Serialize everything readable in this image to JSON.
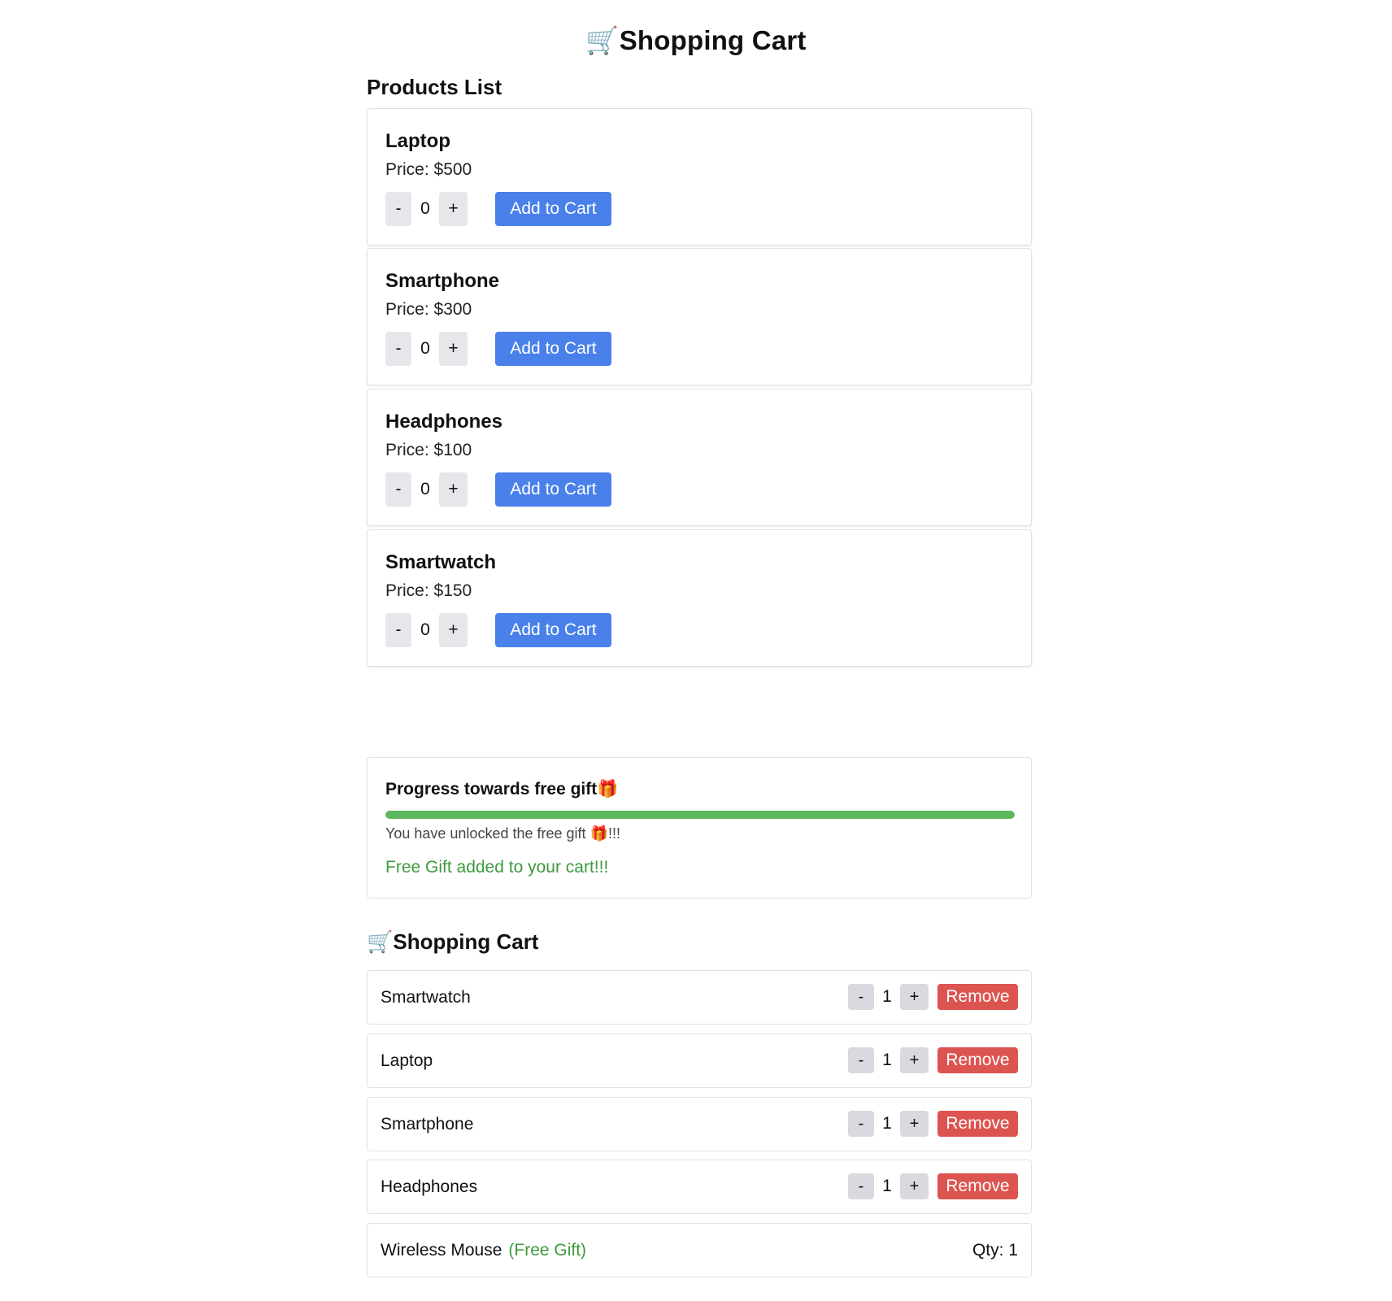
{
  "header": {
    "title": "Shopping Cart",
    "title_icon": "🛒"
  },
  "products_section": {
    "heading": "Products List",
    "price_prefix": "Price: ",
    "add_label": "Add to Cart",
    "minus_label": "-",
    "plus_label": "+",
    "items": [
      {
        "name": "Laptop",
        "price": "$500",
        "qty": "0"
      },
      {
        "name": "Smartphone",
        "price": "$300",
        "qty": "0"
      },
      {
        "name": "Headphones",
        "price": "$100",
        "qty": "0"
      },
      {
        "name": "Smartwatch",
        "price": "$150",
        "qty": "0"
      }
    ]
  },
  "progress": {
    "title": "Progress towards free gift",
    "gift_icon": "🎁",
    "percent": 100,
    "message_prefix": "You have unlocked the free gift ",
    "message_suffix": "!!!",
    "gift_added": "Free Gift added to your cart!!!"
  },
  "cart": {
    "heading": "Shopping Cart",
    "heading_icon": "🛒",
    "minus_label": "-",
    "plus_label": "+",
    "remove_label": "Remove",
    "items": [
      {
        "name": "Smartwatch",
        "qty": "1"
      },
      {
        "name": "Laptop",
        "qty": "1"
      },
      {
        "name": "Smartphone",
        "qty": "1"
      },
      {
        "name": "Headphones",
        "qty": "1"
      }
    ],
    "gift_item": {
      "name": "Wireless Mouse",
      "tag": "(Free Gift)",
      "qty_label": "Qty: 1"
    }
  },
  "colors": {
    "add_button": "#4a80ea",
    "remove_button": "#dc5450",
    "progress_fill": "#5cb85c",
    "gift_text": "#3d9a3d"
  }
}
